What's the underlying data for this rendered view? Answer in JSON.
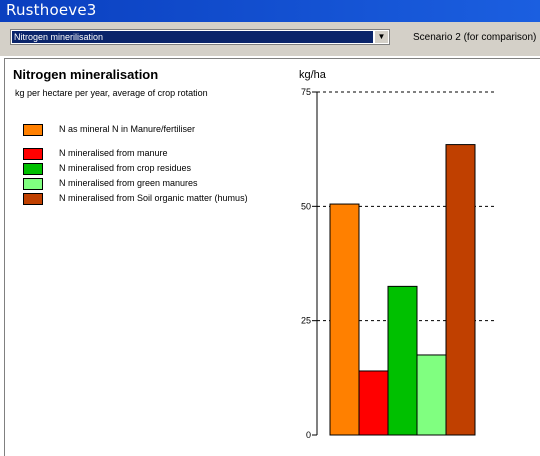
{
  "window": {
    "title": "Rusthoeve3"
  },
  "toolbar": {
    "selected_view": "Nitrogen minerilisation",
    "scenario_label": "Scenario 2 (for comparison)"
  },
  "panel": {
    "heading": "Nitrogen mineralisation",
    "subtitle": "kg per hectare per year, average of crop rotation",
    "unit": "kg/ha"
  },
  "legend": [
    {
      "label": "N as mineral N in Manure/fertiliser",
      "color": "#ff8000"
    },
    {
      "label": "N mineralised from manure",
      "color": "#ff0000"
    },
    {
      "label": "N mineralised from crop residues",
      "color": "#00c000"
    },
    {
      "label": "N mineralised from green manures",
      "color": "#80ff80"
    },
    {
      "label": "N mineralised from Soil organic matter (humus)",
      "color": "#c04000"
    }
  ],
  "chart_data": {
    "type": "bar",
    "ylabel": "kg/ha",
    "ylim": [
      0,
      75
    ],
    "yticks": [
      "0",
      "25",
      "50",
      "75"
    ],
    "grid": "dashed horizontal at 25, 50, 75",
    "categories": [
      "N as mineral N in Manure/fertiliser",
      "N mineralised from manure",
      "N mineralised from crop residues",
      "N mineralised from green manures",
      "N mineralised from Soil organic matter (humus)"
    ],
    "values": [
      50.5,
      14,
      32.5,
      17.5,
      63.5
    ],
    "colors": [
      "#ff8000",
      "#ff0000",
      "#00c000",
      "#80ff80",
      "#c04000"
    ]
  }
}
